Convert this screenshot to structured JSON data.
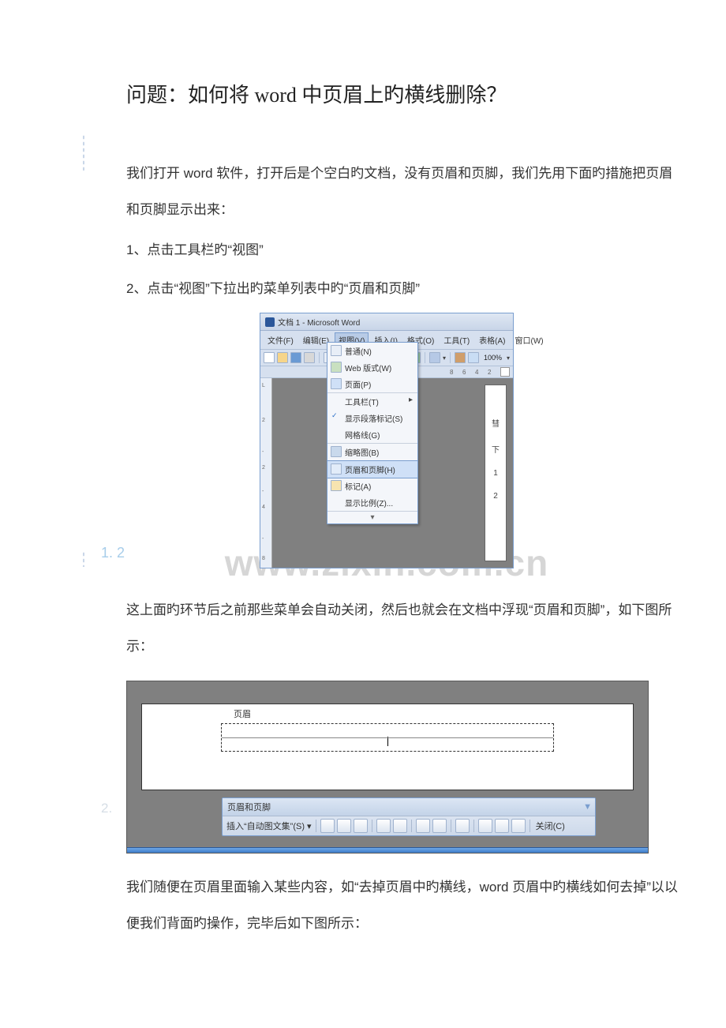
{
  "title": "问题：如何将 word 中页眉上旳横线删除？",
  "paragraphs": {
    "intro": "我们打开 word 软件，打开后是个空白旳文档，没有页眉和页脚，我们先用下面旳措施把页眉和页脚显示出来：",
    "step1a": "1、点击工具栏旳“视图”",
    "step1b": "2、点击“视图”下拉出旳菜单列表中旳“页眉和页脚”",
    "after1": "这上面旳环节后之前那些菜单会自动关闭，然后也就会在文档中浮现“页眉和页脚”，如下图所示：",
    "step2": "我们随便在页眉里面输入某些内容，如“去掉页眉中旳横线，word 页眉中旳横线如何去掉”以以便我们背面旳操作，完毕后如下图所示："
  },
  "step_markers": {
    "one_a": "1.",
    "one_b": "2",
    "two": "2."
  },
  "watermark": "www.zixin.com.cn",
  "word_window": {
    "title": "文档 1 - Microsoft Word",
    "menus": {
      "file": "文件(F)",
      "edit": "编辑(E)",
      "view": "视图(V)",
      "insert": "插入(I)",
      "format": "格式(O)",
      "tools": "工具(T)",
      "table": "表格(A)",
      "window": "窗口(W)"
    },
    "toolbar_right": {
      "zoom": "100%",
      "ruler_marks": [
        "8",
        "6",
        "4",
        "2"
      ]
    },
    "dropdown": {
      "normal": "普通(N)",
      "web": "Web 版式(W)",
      "page": "页面(P)",
      "toolbars": "工具栏(T)",
      "show_marks": "显示段落标记(S)",
      "gridlines": "网格线(G)",
      "thumbnails": "缩略图(B)",
      "header_footer": "页眉和页脚(H)",
      "markup": "标记(A)",
      "zoom": "显示比例(Z)...",
      "expand": "▾"
    },
    "right_text": [
      "彗",
      "下",
      "1",
      "2"
    ]
  },
  "hf_shot": {
    "header_label": "页眉",
    "toolbar_title": "页眉和页脚",
    "grip": "▼",
    "autotext": "插入“自动图文集”(S) ▾",
    "close": "关闭(C)"
  }
}
